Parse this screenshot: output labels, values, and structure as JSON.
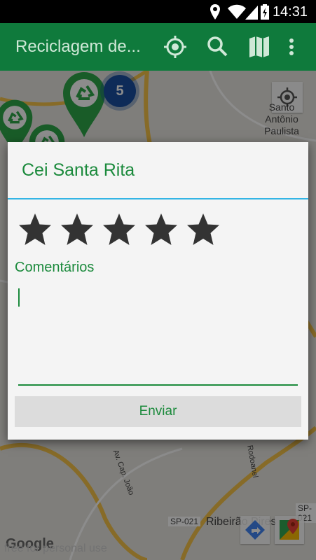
{
  "status_bar": {
    "time": "14:31"
  },
  "app_bar": {
    "title": "Reciclagem de...",
    "actions": [
      "location-target-icon",
      "search-icon",
      "map-icon",
      "overflow-menu-icon"
    ]
  },
  "map": {
    "cluster_count": "5",
    "place_label": "Santo Antônio Paulista",
    "bottom_place": "Ribeirão Pires",
    "road_label": "SP-021",
    "road_label_2": "SP-021",
    "street_label": "Av. Cap. João",
    "street_label_2": "Rodoanel",
    "attribution": "Google",
    "watermark": "free for personal use"
  },
  "dialog": {
    "title": "Cei Santa Rita",
    "rating_stars": 5,
    "rating_value": 0,
    "comments_label": "Comentários",
    "comment_value": "",
    "send_label": "Enviar"
  },
  "colors": {
    "app_bar": "#0f7a3c",
    "accent_green": "#1b8a3c",
    "divider_blue": "#33b5e5",
    "star": "#333333"
  }
}
